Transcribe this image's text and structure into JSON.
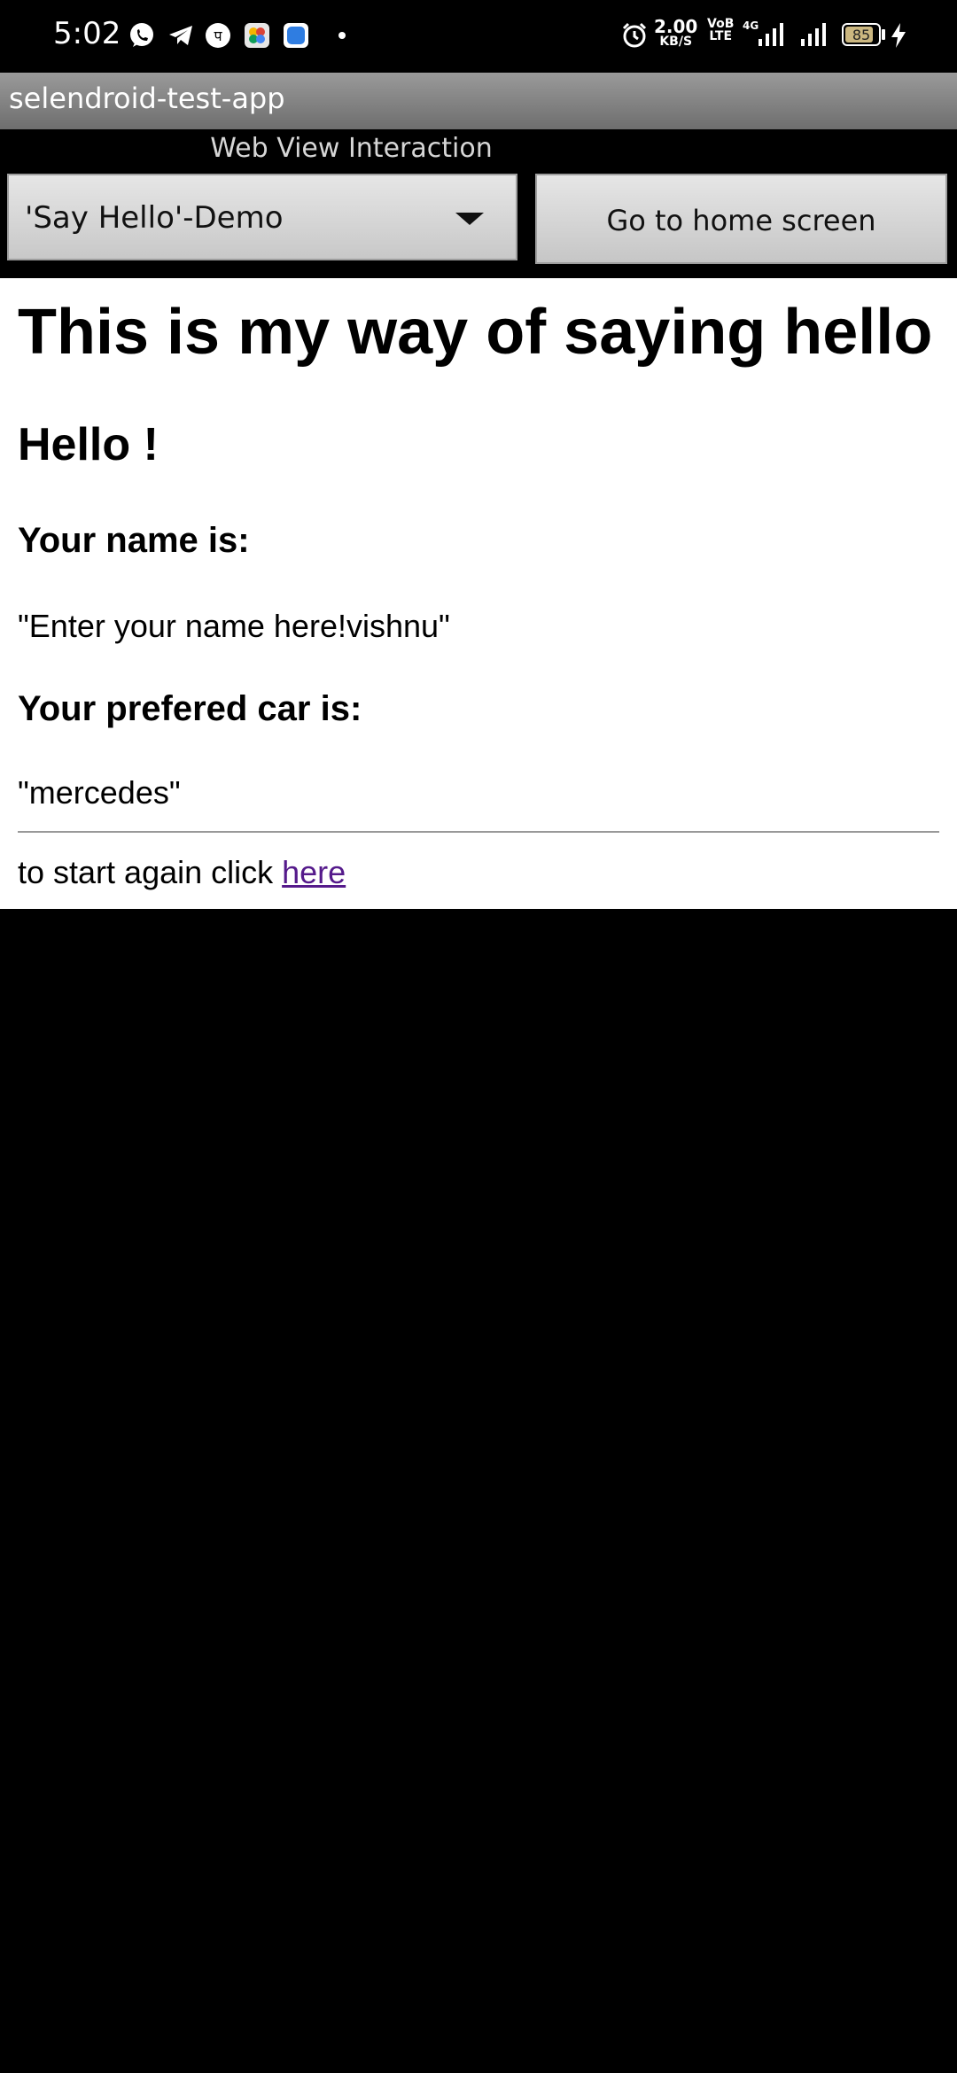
{
  "status_bar": {
    "time": "5:02",
    "speed_value": "2.00",
    "speed_unit": "KB/S",
    "volte_top": "VoB",
    "volte_bottom": "LTE",
    "net_type": "4G",
    "battery": "85",
    "battery_level": 0.85,
    "notification_icons": [
      "whatsapp-icon",
      "telegram-icon",
      "phonepe-icon",
      "photos-icon",
      "app-icon"
    ],
    "colors": {
      "background": "#000000",
      "battery_fill": "#cbb780"
    }
  },
  "app": {
    "title": "selendroid-test-app",
    "subheader_title": "Web View Interaction",
    "spinner_value": "'Say Hello'-Demo",
    "home_button": "Go to home screen"
  },
  "web": {
    "heading": "This is my way of saying hello",
    "greeting": "Hello !",
    "name_label": "Your name is:",
    "name_value": "\"Enter your name here!vishnu\"",
    "car_label": "Your prefered car is:",
    "car_value": "\"mercedes\"",
    "restart_text": "to start again click ",
    "restart_link": "here",
    "colors": {
      "link": "#551a8b"
    }
  }
}
